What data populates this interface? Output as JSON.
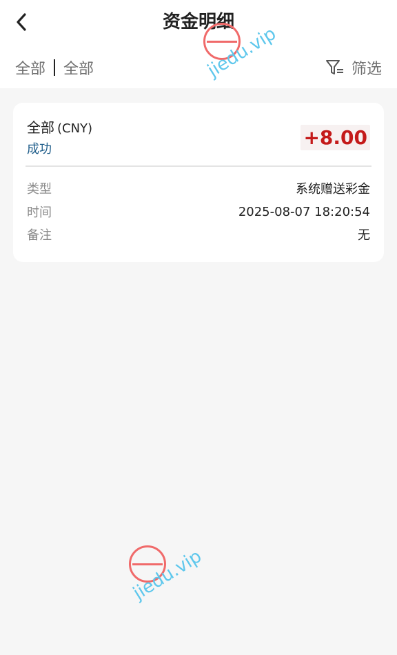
{
  "header": {
    "title": "资金明细",
    "back_icon": "chevron-left-icon"
  },
  "filters": {
    "tab1": "全部",
    "tab2": "全部",
    "filter_label": "筛选",
    "filter_icon": "funnel-icon"
  },
  "record": {
    "account": "全部",
    "currency": "(CNY)",
    "status": "成功",
    "amount": "+8.00",
    "fields": [
      {
        "key": "类型",
        "value": "系统赠送彩金"
      },
      {
        "key": "时间",
        "value": "2025-08-07 18:20:54"
      },
      {
        "key": "备注",
        "value": "无"
      }
    ]
  },
  "watermark": {
    "text": "jiedu.vip"
  },
  "colors": {
    "amount": "#c41a1a",
    "status": "#1f5d8a",
    "background": "#f6f6f6",
    "watermark_text": "#5ec7ec",
    "watermark_circle": "#f06a6a"
  }
}
